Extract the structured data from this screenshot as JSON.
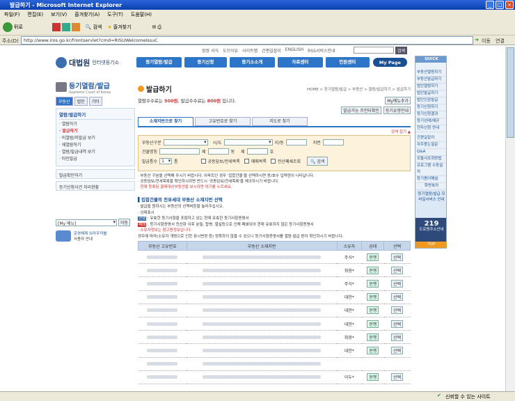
{
  "window": {
    "title": "발급하기 - Microsoft Internet Explorer"
  },
  "menu": [
    "파일(F)",
    "편집(E)",
    "보기(V)",
    "즐겨찾기(A)",
    "도구(T)",
    "도움말(H)"
  ],
  "toolbar": {
    "back": "뒤로",
    "search": "검색",
    "favorites": "즐겨찾기"
  },
  "address": {
    "label": "주소(D)",
    "url": "http://www.iros.go.kr/frontservlet?cmd=RISUWelcomeIssuC",
    "go": "이동",
    "links": "연결"
  },
  "status": {
    "left": "",
    "zone": "신뢰할 수 있는 사이트"
  },
  "topnav": [
    "쌍쌍 서식",
    "도므이유",
    "사이트맵",
    "간편길잡이",
    "ENGLISH",
    "RSS서비스안내"
  ],
  "topsearch_btn": "검색",
  "logo": {
    "name": "대법원",
    "sub": "인터넷등기소"
  },
  "mainnav": [
    "등기열람/발급",
    "등기신청",
    "등기소소개",
    "자료센터",
    "민원센터",
    "My Page"
  ],
  "left": {
    "title": "등기열람/발급",
    "subtitle": "Supreme Court of Korea",
    "tabs": [
      "부동산",
      "법인",
      "기타"
    ],
    "section": "열람/발급하기",
    "items": [
      "열람하기",
      "발급하기",
      "미열람/미발급 보기",
      "재열람하기",
      "열람/발급내역 보기",
      "타인발급"
    ],
    "links": [
      "발급확인하기",
      "등기신청사건 처리현황"
    ],
    "mymenu": "[My 메뉴]",
    "go": "이동",
    "help_title": "운영체제 브라우저별",
    "help_sub": "사용자 안내"
  },
  "page": {
    "title": "발급하기",
    "breadcrumb": "HOME > 등기열람/발급 > 부동산 > 열람/발급하기 > 발급하기",
    "fee_pre": "열람수수료는 ",
    "fee1": "500원",
    "fee_mid": ", 발급수수료는 ",
    "fee2": "800원",
    "fee_post": " 입니다.",
    "mymenu_add": "My메뉴추가",
    "btn_terminal": "발급가능 프린터확인",
    "btn_guide": "등기유형안내"
  },
  "search_tabs": [
    "소재지번으로 찾기",
    "고유번호로 찾기",
    "지도로 찾기"
  ],
  "search_opts": "검색 접기",
  "form": {
    "type_label": "부동산구분",
    "sido_label": "시/도",
    "ri_label": "리/동",
    "jibun_label": "지번",
    "bldg_label": "건물명칭",
    "je_label": "제",
    "dong": "동",
    "ho": "호",
    "count_label": "발급통수",
    "count": "1",
    "tong": "통",
    "check1": "공동담보/전세목록",
    "check2": "매매목록",
    "check3": "전산폐쇄조회",
    "search_btn": "검색"
  },
  "notes": [
    "부동산 구분을 선택해 주시기 바랍니다. 아파트인 경우 '집합건물'을 선택하시면 동/호수 입력란이 나타납니다.",
    "공동담보/전세목록을 확인하시려면 반드시 '공동담보/전세목록'을 체크하시기 바랍니다.",
    "현재 등록된 결제대상부동산을 보시려면 여기를 누르세요."
  ],
  "result": {
    "title": "집합건물의 전유세대 부동산 소재지번 선택",
    "l1": "발급을 원하시는 부동산의 선택버튼을 눌러주십시오.",
    "l2": "상태표시",
    "tag1": "현행",
    "d1": ": 유효한 등기사항을 포함하고 있는 현재 유효한 등기사항증명서",
    "tag2": "폐쇄",
    "d2": ": 등기사항증명서 전산화 이후 분필, 합병, 멸실등으로 인해 폐쇄되어 현재 유효하지 않은 등기사항증명서",
    "l3": "소유자정보는 참고용정보입니다.",
    "l4": "경우에 따라(소유자 개명으로 인한 표시변경 등) 정확하지 않을 수 있으니 등기사항증명서를 열람·발급 받아 확인하시기 바랍니다."
  },
  "table": {
    "headers": [
      "부동산 고유번호",
      "부동산 소재지번",
      "소유자",
      "상태",
      "선택"
    ],
    "rows": [
      [
        "주식*",
        "현행",
        "선택"
      ],
      [
        "최용*",
        "현행",
        "선택"
      ],
      [
        "주식*",
        "현행",
        "선택"
      ],
      [
        "대한*",
        "현행",
        "선택"
      ],
      [
        "대한*",
        "현행",
        "선택"
      ],
      [
        "대한*",
        "현행",
        "선택"
      ],
      [
        "최용*",
        "현행",
        "선택"
      ],
      [
        "대한*",
        "현행",
        "선택"
      ],
      [
        "",
        "",
        ""
      ],
      [
        "이두*",
        "현행",
        "선택"
      ]
    ]
  },
  "right": {
    "quick": "QUICK",
    "items": [
      "부동산열람하기",
      "부동산발급하기",
      "법인열람하기",
      "법인발급하기",
      "법인인감발급",
      "등기신청하기",
      "등기신청결과",
      "등기선례/예규",
      "전자신청 안내"
    ],
    "items2": [
      "간편길잡이",
      "자주묻는질문",
      "Q&A",
      "모듈서조회방법",
      "프로그램 수동설치",
      "등기용어해설"
    ],
    "home": "화면복귀",
    "mobile": "등기열람/발급 모바일서비스 안내",
    "tel": "219",
    "tel_label": "도로명주소안내",
    "top": "TOP"
  },
  "colors": {
    "titlebar": "#0a3fb0",
    "nav": "#2d75c8",
    "accent": "#d9502e"
  }
}
